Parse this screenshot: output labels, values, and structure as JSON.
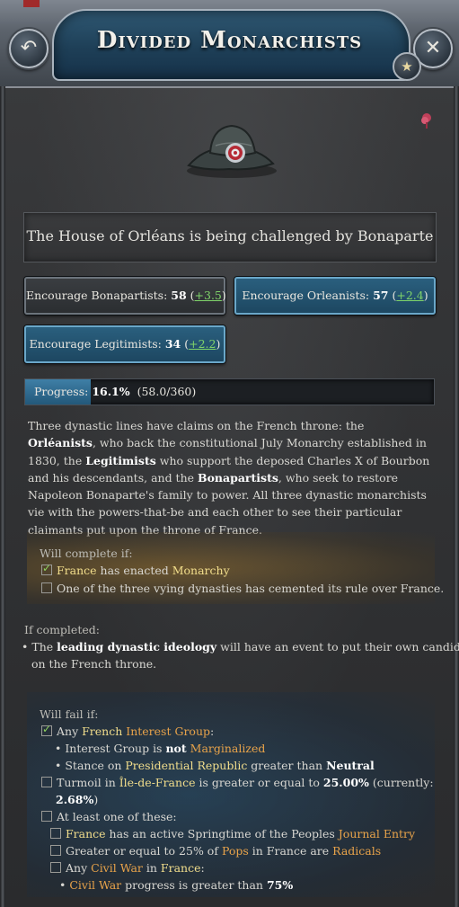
{
  "header": {
    "title": "Divided Monarchists",
    "back_icon": "↶",
    "close_icon": "✕",
    "favorite_icon": "★"
  },
  "event_title": "The House of Orléans is being challenged by Bonaparte",
  "buttons": {
    "bonapartists": {
      "label": "Encourage Bonapartists: ",
      "value": "58",
      "delta": "+3.5"
    },
    "orleanists": {
      "label": "Encourage Orleanists: ",
      "value": "57",
      "delta": "+2.4"
    },
    "legitimists": {
      "label": "Encourage Legitimists: ",
      "value": "34",
      "delta": "+2.2"
    }
  },
  "progress": {
    "label": "Progress: ",
    "percent": "16.1%",
    "detail": "(58.0/360)",
    "fraction": 0.161
  },
  "description": {
    "p1": "Three dynastic lines have claims on the French throne: the ",
    "orleanists": "Orléanists",
    "p2": ", who back the constitutional July Monarchy established in 1830, the ",
    "legitimists": "Legitimists",
    "p3": " who support the deposed Charles X of Bourbon and his descendants, and the ",
    "bonapartists": "Bonapartists",
    "p4": ", who seek to restore Napoleon Bonaparte's family to power. All three dynastic monarchists vie with the powers-that-be and each other to see their particular claimants put upon the throne of France."
  },
  "complete": {
    "header": "Will complete if:",
    "c1_a": "France",
    "c1_b": " has enacted ",
    "c1_c": "Monarchy",
    "c2": "One of the three vying dynasties has cemented its rule over France."
  },
  "completed": {
    "header": "If completed:",
    "bullet": "•",
    "a": "The ",
    "b": "leading dynastic ideology",
    "c": " will have an event to put their own candidate",
    "d": "on the French throne."
  },
  "fail": {
    "header": "Will fail if:",
    "any": "Any ",
    "french": "French",
    "interest_group": "Interest Group",
    "colon": ":",
    "ig_line_a": "Interest Group is ",
    "ig_line_b": "not",
    "ig_line_c": "Marginalized",
    "stance_a": "Stance on ",
    "stance_b": "Presidential Republic",
    "stance_c": " greater than ",
    "stance_d": "Neutral",
    "turmoil_a": "Turmoil in ",
    "turmoil_b": "Île-de-France",
    "turmoil_c": " is greater or equal to ",
    "turmoil_d": "25.00%",
    "turmoil_e": " (currently:",
    "turmoil_f": "2.68%",
    "turmoil_g": ")",
    "atleast": "At least one of these:",
    "sub1_a": "France",
    "sub1_b": " has an active Springtime of the Peoples ",
    "sub1_c": "Journal Entry",
    "sub2_a": "Greater or equal to 25% of ",
    "sub2_b": "Pops",
    "sub2_c": " in France are ",
    "sub2_d": "Radicals",
    "sub3_a": "Any ",
    "sub3_b": "Civil War",
    "sub3_c": " in ",
    "sub3_d": "France",
    "sub3_e": ":",
    "sub4_a": "Civil War",
    "sub4_b": " progress is greater than ",
    "sub4_c": "75%"
  },
  "colors": {
    "accent_blue": "#2a5f7e",
    "positive": "#7fd46a",
    "highlight_yellow": "#f2de8c",
    "highlight_orange": "#e8a34a"
  }
}
